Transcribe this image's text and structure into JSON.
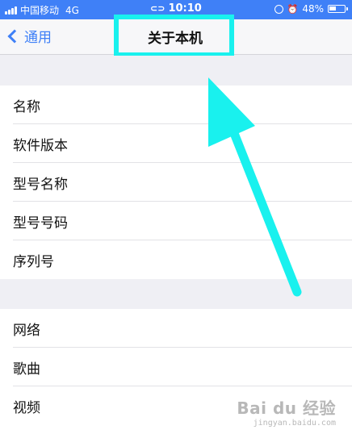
{
  "status_bar": {
    "carrier": "中国移动",
    "network": "4G",
    "time": "10:10",
    "battery": "48%"
  },
  "nav": {
    "back_label": "通用",
    "title": "关于本机"
  },
  "groups": [
    {
      "items": [
        "名称",
        "软件版本",
        "型号名称",
        "型号号码",
        "序列号"
      ]
    },
    {
      "items": [
        "网络",
        "歌曲",
        "视频"
      ]
    }
  ],
  "watermark": {
    "logo": "Bai du 经验",
    "url": "jingyan.baidu.com"
  },
  "colors": {
    "status_bar": "#3f80f7",
    "highlight": "#19f1ee",
    "accent": "#3f80f7"
  }
}
